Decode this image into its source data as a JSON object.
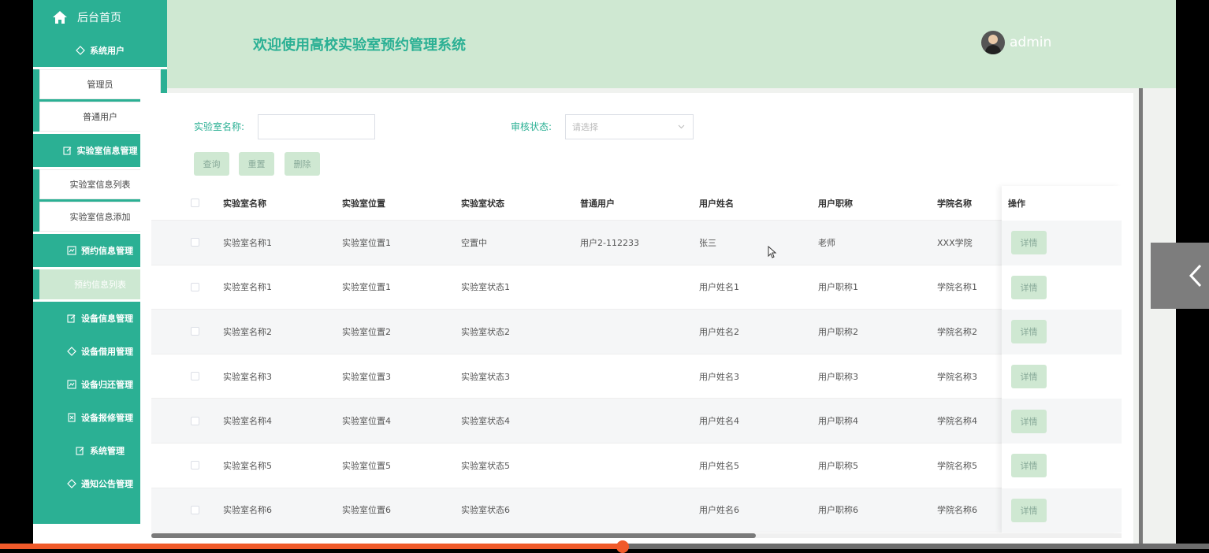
{
  "sidebar": {
    "home_label": "后台首页",
    "groups": [
      {
        "label": "系统用户",
        "items": [
          "管理员",
          "普通用户"
        ]
      },
      {
        "label": "实验室信息管理",
        "items": [
          "实验室信息列表",
          "实验室信息添加"
        ]
      },
      {
        "label": "预约信息管理",
        "items": [
          "预约信息列表"
        ]
      },
      {
        "label": "设备信息管理",
        "items": []
      },
      {
        "label": "设备借用管理",
        "items": []
      },
      {
        "label": "设备归还管理",
        "items": []
      },
      {
        "label": "设备报修管理",
        "items": []
      },
      {
        "label": "系统管理",
        "items": []
      },
      {
        "label": "通知公告管理",
        "items": []
      }
    ],
    "active_item": "预约信息列表"
  },
  "header": {
    "title": "欢迎使用高校实验室预约管理系统",
    "username": "admin"
  },
  "search": {
    "name_label": "实验室名称:",
    "name_value": "",
    "status_label": "审核状态:",
    "status_placeholder": "请选择"
  },
  "buttons": {
    "query": "查询",
    "reset": "重置",
    "delete": "删除"
  },
  "table": {
    "columns": [
      "实验室名称",
      "实验室位置",
      "实验室状态",
      "普通用户",
      "用户姓名",
      "用户职称",
      "学院名称",
      "操作"
    ],
    "detail_label": "详情",
    "rows": [
      [
        "实验室名称1",
        "实验室位置1",
        "空置中",
        "用户2-112233",
        "张三",
        "老师",
        "XXX学院"
      ],
      [
        "实验室名称1",
        "实验室位置1",
        "实验室状态1",
        "",
        "用户姓名1",
        "用户职称1",
        "学院名称1"
      ],
      [
        "实验室名称2",
        "实验室位置2",
        "实验室状态2",
        "",
        "用户姓名2",
        "用户职称2",
        "学院名称2"
      ],
      [
        "实验室名称3",
        "实验室位置3",
        "实验室状态3",
        "",
        "用户姓名3",
        "用户职称3",
        "学院名称3"
      ],
      [
        "实验室名称4",
        "实验室位置4",
        "实验室状态4",
        "",
        "用户姓名4",
        "用户职称4",
        "学院名称4"
      ],
      [
        "实验室名称5",
        "实验室位置5",
        "实验室状态5",
        "",
        "用户姓名5",
        "用户职称5",
        "学院名称5"
      ],
      [
        "实验室名称6",
        "实验室位置6",
        "实验室状态6",
        "",
        "用户姓名6",
        "用户职称6",
        "学院名称6"
      ]
    ]
  },
  "colors": {
    "primary": "#2bb094",
    "header_bg": "#cfe8d2",
    "button_bg": "#cfe8d2"
  },
  "video_progress": 0.515
}
